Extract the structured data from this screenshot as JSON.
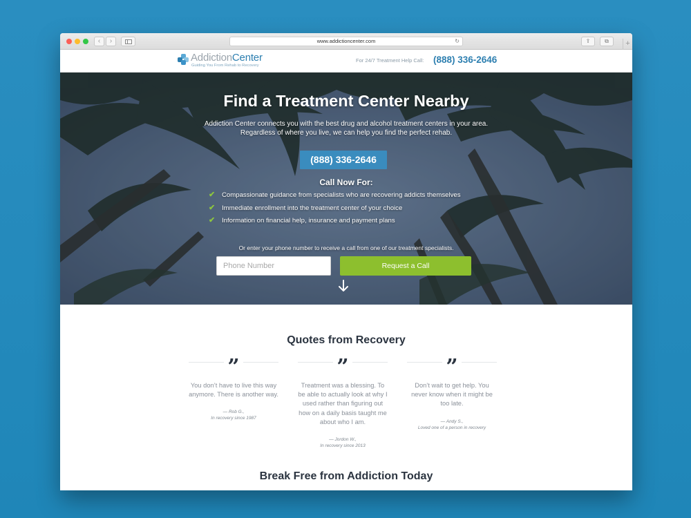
{
  "browser": {
    "url": "www.addictioncenter.com",
    "back_glyph": "‹",
    "forward_glyph": "›",
    "reload_glyph": "↻",
    "share_glyph": "⇪",
    "tabs_glyph": "⧉",
    "newtab_glyph": "+"
  },
  "header": {
    "logo_word1": "Addiction",
    "logo_word2": "Center",
    "tagline": "Guiding You From Rehab to Recovery",
    "help_text": "For 24/7 Treatment Help Call:",
    "phone": "(888) 336-2646"
  },
  "hero": {
    "title": "Find a Treatment Center Nearby",
    "subtitle_line1": "Addiction Center connects you with the best drug and alcohol treatment centers in your area.",
    "subtitle_line2": "Regardless of where you live, we can help you find the perfect rehab.",
    "phone": "(888) 336-2646",
    "call_now": "Call Now For:",
    "check_glyph": "✔",
    "benefits": [
      "Compassionate guidance from specialists who are recovering addicts themselves",
      "Immediate enrollment into the treatment center of your choice",
      "Information on financial help, insurance and payment plans"
    ],
    "callback_note": "Or enter your phone number to receive a call from one of our treatment specialists.",
    "phone_placeholder": "Phone Number",
    "request_button": "Request a Call"
  },
  "quotes": {
    "title": "Quotes from Recovery",
    "mark": "”",
    "items": [
      {
        "text": "You don’t have to live this way anymore. There is another way.",
        "author": "— Rob G.,",
        "detail": "In recovery since 1987"
      },
      {
        "text": "Treatment was a blessing. To be able to actually look at why I used rather than figuring out how on a daily basis taught me about who I am.",
        "author": "— Jordon W.,",
        "detail": "In recovery since 2013"
      },
      {
        "text": "Don’t wait to get help. You never know when it might be too late.",
        "author": "— Andy S.,",
        "detail": "Loved one of a person in recovery"
      }
    ]
  },
  "break_free": {
    "title": "Break Free from Addiction Today"
  },
  "colors": {
    "brand_blue": "#2d7fb0",
    "cta_green": "#8dbf2e",
    "check_green": "#8dc63f",
    "logo_cross": [
      "#5aa9d6",
      "#2d7fb0",
      "#8bc4e3",
      "#3c93c8"
    ]
  }
}
